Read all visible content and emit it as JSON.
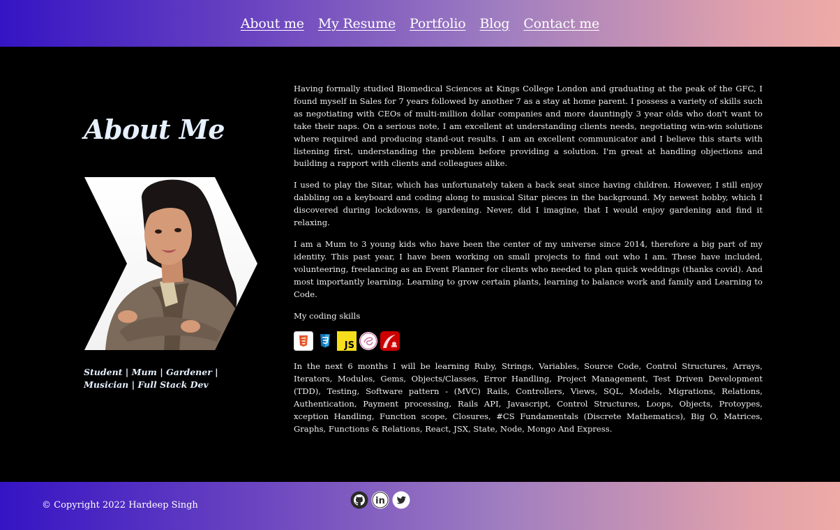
{
  "nav": {
    "items": [
      {
        "label": "About me"
      },
      {
        "label": "My Resume"
      },
      {
        "label": "Portfolio"
      },
      {
        "label": "Blog"
      },
      {
        "label": "Contact me"
      }
    ]
  },
  "about": {
    "title": "About Me",
    "tagline": "Student | Mum | Gardener | Musician | Full Stack Dev",
    "paragraphs": [
      "Having formally studied Biomedical Sciences at Kings College London and graduating at the peak of the GFC, I found myself in Sales for 7 years followed by another 7 as a stay at home parent. I possess a variety of skills such as negotiating with CEOs of multi-million dollar companies and more dauntingly 3 year olds who don't want to take their naps. On a serious note, I am excellent at understanding clients needs, negotiating win-win solutions where required and producing stand-out results. I am an excellent communicator and I believe this starts with listening first, understanding the problem before providing a solution. I'm great at handling objections and building a rapport with clients and colleagues alike.",
      "I used to play the Sitar, which has unfortunately taken a back seat since having children. However, I still enjoy dabbling on a keyboard and coding along to musical Sitar pieces in the background. My newest hobby, which I discovered during lockdowns, is gardening. Never, did I imagine, that I would enjoy gardening and find it relaxing.",
      "I am a Mum to 3 young kids who have been the center of my universe since 2014, therefore a big part of my identity. This past year, I have been working on small projects to find out who I am. These have included, volunteering, freelancing as an Event Planner for clients who needed to plan quick weddings (thanks covid). And most importantly learning. Learning to grow certain plants, learning to balance work and family and Learning to Code."
    ],
    "skills_label": "My coding skills",
    "skills": [
      {
        "icon": "html5-icon"
      },
      {
        "icon": "css3-icon"
      },
      {
        "icon": "javascript-icon",
        "text": "JS"
      },
      {
        "icon": "sass-icon"
      },
      {
        "icon": "rails-icon"
      }
    ],
    "learning": "In the next 6 months I will be learning Ruby, Strings, Variables, Source Code, Control Structures, Arrays, Iterators, Modules, Gems, Objects/Classes, Error Handling, Project Management, Test Driven Development (TDD), Testing, Software pattern - (MVC) Rails, Controllers, Views, SQL, Models, Migrations, Relations, Authentication, Payment processing, Rails API, Javascript, Control Structures, Loops, Objects, Protoypes, xception Handling, Function scope, Closures, #CS Fundamentals (Discrete Mathematics), Big O, Matrices, Graphs, Functions & Relations, React, JSX, State, Node, Mongo And Express."
  },
  "footer": {
    "copyright": "© Copyright 2022 Hardeep Singh",
    "social": [
      {
        "icon": "github-icon"
      },
      {
        "icon": "linkedin-icon",
        "text": "in"
      },
      {
        "icon": "twitter-icon"
      }
    ]
  },
  "colors": {
    "gradient_start": "#3514c4",
    "gradient_end": "#eeaaa6",
    "background": "#000000",
    "heading": "#e6f0ff"
  }
}
